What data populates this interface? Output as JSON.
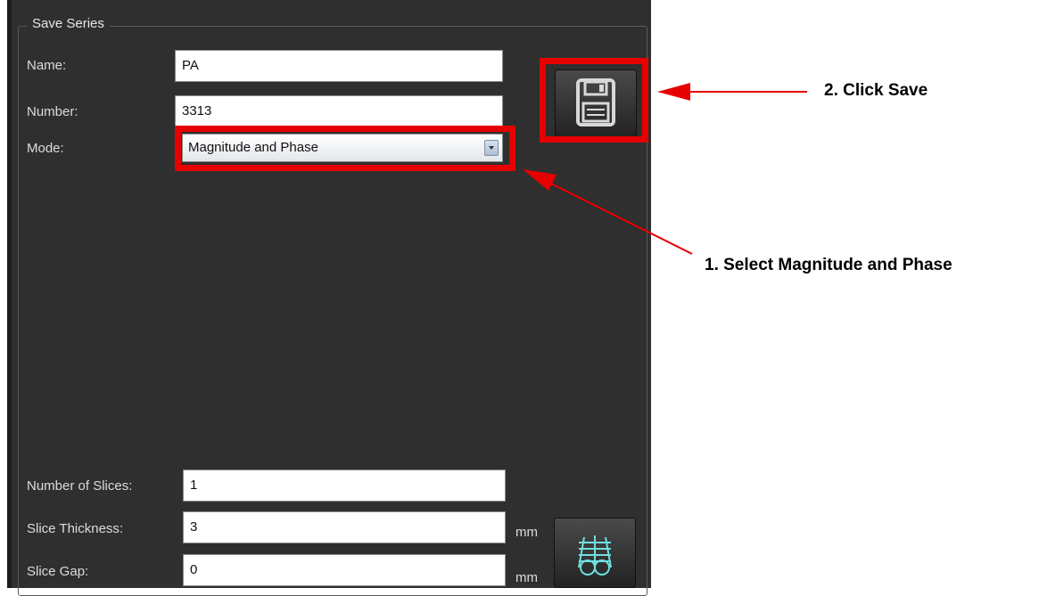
{
  "group": {
    "title": "Save Series"
  },
  "fields": {
    "name": {
      "label": "Name:",
      "value": "PA"
    },
    "number": {
      "label": "Number:",
      "value": "3313"
    },
    "mode": {
      "label": "Mode:",
      "value": "Magnitude and Phase"
    },
    "num_slices": {
      "label": "Number of Slices:",
      "value": "1"
    },
    "slice_thickness": {
      "label": "Slice Thickness:",
      "value": "3",
      "unit": "mm"
    },
    "slice_gap": {
      "label": "Slice Gap:",
      "value": "0",
      "unit": "mm"
    }
  },
  "icons": {
    "save": "floppy-disk-icon",
    "slices": "slice-planes-icon",
    "dropdown": "chevron-down-icon"
  },
  "annotations": {
    "step1": "1. Select Magnitude and Phase",
    "step2": "2. Click Save"
  },
  "colors": {
    "panel": "#2f2f2f",
    "highlight": "#e60000",
    "icon_cyan": "#6fe0e0"
  }
}
